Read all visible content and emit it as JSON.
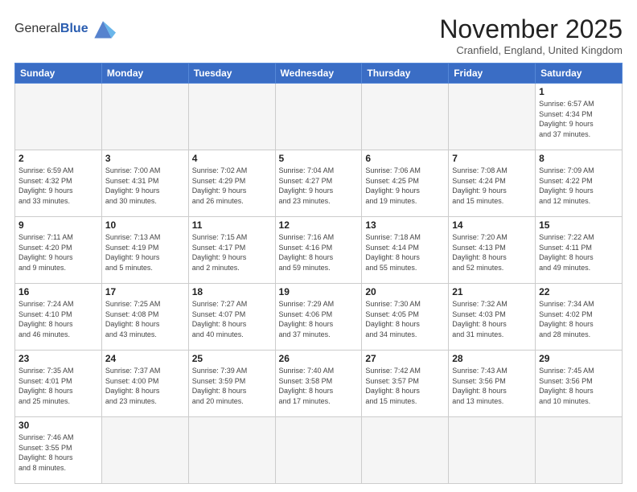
{
  "header": {
    "logo_general": "General",
    "logo_blue": "Blue",
    "month_title": "November 2025",
    "location": "Cranfield, England, United Kingdom"
  },
  "days_of_week": [
    "Sunday",
    "Monday",
    "Tuesday",
    "Wednesday",
    "Thursday",
    "Friday",
    "Saturday"
  ],
  "weeks": [
    [
      {
        "day": "",
        "empty": true
      },
      {
        "day": "",
        "empty": true
      },
      {
        "day": "",
        "empty": true
      },
      {
        "day": "",
        "empty": true
      },
      {
        "day": "",
        "empty": true
      },
      {
        "day": "",
        "empty": true
      },
      {
        "day": "1",
        "info": "Sunrise: 6:57 AM\nSunset: 4:34 PM\nDaylight: 9 hours\nand 37 minutes."
      }
    ],
    [
      {
        "day": "2",
        "info": "Sunrise: 6:59 AM\nSunset: 4:32 PM\nDaylight: 9 hours\nand 33 minutes."
      },
      {
        "day": "3",
        "info": "Sunrise: 7:00 AM\nSunset: 4:31 PM\nDaylight: 9 hours\nand 30 minutes."
      },
      {
        "day": "4",
        "info": "Sunrise: 7:02 AM\nSunset: 4:29 PM\nDaylight: 9 hours\nand 26 minutes."
      },
      {
        "day": "5",
        "info": "Sunrise: 7:04 AM\nSunset: 4:27 PM\nDaylight: 9 hours\nand 23 minutes."
      },
      {
        "day": "6",
        "info": "Sunrise: 7:06 AM\nSunset: 4:25 PM\nDaylight: 9 hours\nand 19 minutes."
      },
      {
        "day": "7",
        "info": "Sunrise: 7:08 AM\nSunset: 4:24 PM\nDaylight: 9 hours\nand 15 minutes."
      },
      {
        "day": "8",
        "info": "Sunrise: 7:09 AM\nSunset: 4:22 PM\nDaylight: 9 hours\nand 12 minutes."
      }
    ],
    [
      {
        "day": "9",
        "info": "Sunrise: 7:11 AM\nSunset: 4:20 PM\nDaylight: 9 hours\nand 9 minutes."
      },
      {
        "day": "10",
        "info": "Sunrise: 7:13 AM\nSunset: 4:19 PM\nDaylight: 9 hours\nand 5 minutes."
      },
      {
        "day": "11",
        "info": "Sunrise: 7:15 AM\nSunset: 4:17 PM\nDaylight: 9 hours\nand 2 minutes."
      },
      {
        "day": "12",
        "info": "Sunrise: 7:16 AM\nSunset: 4:16 PM\nDaylight: 8 hours\nand 59 minutes."
      },
      {
        "day": "13",
        "info": "Sunrise: 7:18 AM\nSunset: 4:14 PM\nDaylight: 8 hours\nand 55 minutes."
      },
      {
        "day": "14",
        "info": "Sunrise: 7:20 AM\nSunset: 4:13 PM\nDaylight: 8 hours\nand 52 minutes."
      },
      {
        "day": "15",
        "info": "Sunrise: 7:22 AM\nSunset: 4:11 PM\nDaylight: 8 hours\nand 49 minutes."
      }
    ],
    [
      {
        "day": "16",
        "info": "Sunrise: 7:24 AM\nSunset: 4:10 PM\nDaylight: 8 hours\nand 46 minutes."
      },
      {
        "day": "17",
        "info": "Sunrise: 7:25 AM\nSunset: 4:08 PM\nDaylight: 8 hours\nand 43 minutes."
      },
      {
        "day": "18",
        "info": "Sunrise: 7:27 AM\nSunset: 4:07 PM\nDaylight: 8 hours\nand 40 minutes."
      },
      {
        "day": "19",
        "info": "Sunrise: 7:29 AM\nSunset: 4:06 PM\nDaylight: 8 hours\nand 37 minutes."
      },
      {
        "day": "20",
        "info": "Sunrise: 7:30 AM\nSunset: 4:05 PM\nDaylight: 8 hours\nand 34 minutes."
      },
      {
        "day": "21",
        "info": "Sunrise: 7:32 AM\nSunset: 4:03 PM\nDaylight: 8 hours\nand 31 minutes."
      },
      {
        "day": "22",
        "info": "Sunrise: 7:34 AM\nSunset: 4:02 PM\nDaylight: 8 hours\nand 28 minutes."
      }
    ],
    [
      {
        "day": "23",
        "info": "Sunrise: 7:35 AM\nSunset: 4:01 PM\nDaylight: 8 hours\nand 25 minutes."
      },
      {
        "day": "24",
        "info": "Sunrise: 7:37 AM\nSunset: 4:00 PM\nDaylight: 8 hours\nand 23 minutes."
      },
      {
        "day": "25",
        "info": "Sunrise: 7:39 AM\nSunset: 3:59 PM\nDaylight: 8 hours\nand 20 minutes."
      },
      {
        "day": "26",
        "info": "Sunrise: 7:40 AM\nSunset: 3:58 PM\nDaylight: 8 hours\nand 17 minutes."
      },
      {
        "day": "27",
        "info": "Sunrise: 7:42 AM\nSunset: 3:57 PM\nDaylight: 8 hours\nand 15 minutes."
      },
      {
        "day": "28",
        "info": "Sunrise: 7:43 AM\nSunset: 3:56 PM\nDaylight: 8 hours\nand 13 minutes."
      },
      {
        "day": "29",
        "info": "Sunrise: 7:45 AM\nSunset: 3:56 PM\nDaylight: 8 hours\nand 10 minutes."
      }
    ],
    [
      {
        "day": "30",
        "info": "Sunrise: 7:46 AM\nSunset: 3:55 PM\nDaylight: 8 hours\nand 8 minutes.",
        "last": true
      },
      {
        "day": "",
        "empty": true,
        "last": true
      },
      {
        "day": "",
        "empty": true,
        "last": true
      },
      {
        "day": "",
        "empty": true,
        "last": true
      },
      {
        "day": "",
        "empty": true,
        "last": true
      },
      {
        "day": "",
        "empty": true,
        "last": true
      },
      {
        "day": "",
        "empty": true,
        "last": true
      }
    ]
  ]
}
